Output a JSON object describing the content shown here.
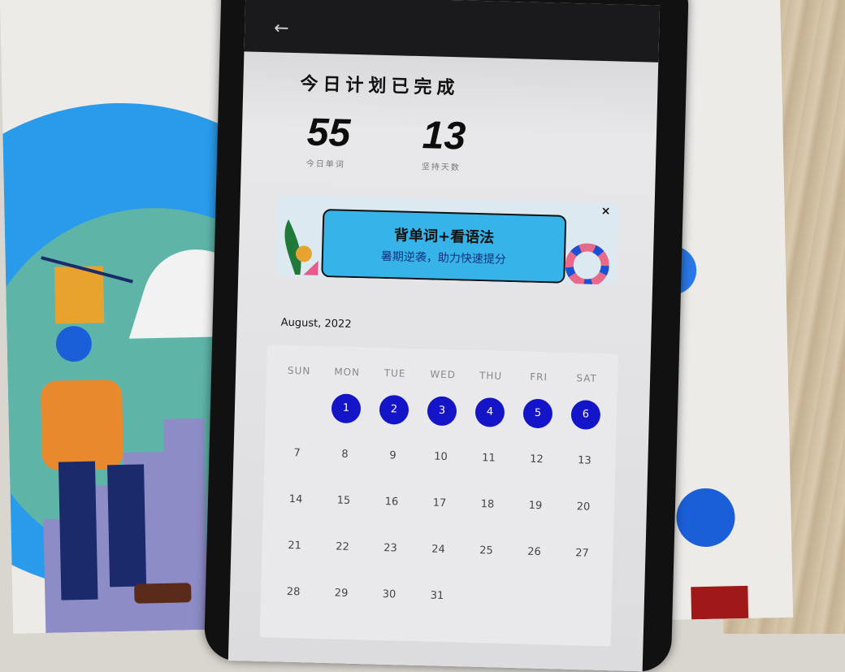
{
  "screen": {
    "headline": "今日计划已完成",
    "stats": [
      {
        "value": "55",
        "label": "今日单词"
      },
      {
        "value": "13",
        "label": "坚持天数"
      }
    ],
    "banner": {
      "title": "背单词+看语法",
      "subtitle": "暑期逆袭，助力快速提分",
      "close_glyph": "×"
    },
    "calendar": {
      "month": "August, 2022",
      "weekdays": [
        "SUN",
        "MON",
        "TUE",
        "WED",
        "THU",
        "FRI",
        "SAT"
      ],
      "days": [
        "1",
        "2",
        "3",
        "4",
        "5",
        "6",
        "7",
        "8",
        "9",
        "10",
        "11",
        "12",
        "13",
        "14",
        "15",
        "16",
        "17",
        "18",
        "19",
        "20",
        "21",
        "22",
        "23",
        "24",
        "25",
        "26",
        "27",
        "28",
        "29",
        "30",
        "31"
      ],
      "completed_days": [
        "1",
        "2",
        "3",
        "4",
        "5",
        "6"
      ],
      "completed_color": "#1414c8",
      "first_weekday_index": 1
    },
    "back_icon": "back-arrow-icon",
    "back_glyph": "←"
  },
  "colors": {
    "banner_blue": "#36b4ea",
    "poster_blue": "#2a9bea",
    "poster_orange": "#e8892e"
  }
}
